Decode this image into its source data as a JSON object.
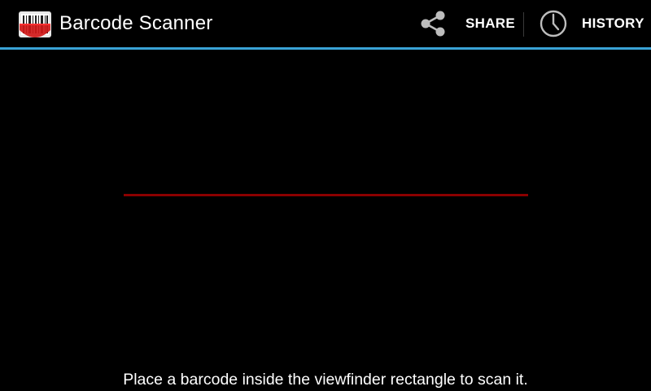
{
  "app": {
    "title": "Barcode Scanner",
    "icon": "barcode-scanner-icon"
  },
  "actions": {
    "share_label": "SHARE",
    "share_icon": "share-icon",
    "history_label": "HISTORY",
    "history_icon": "clock-icon"
  },
  "viewfinder": {
    "status_text": "Place a barcode inside the viewfinder rectangle to scan it."
  },
  "colors": {
    "background": "#000000",
    "accent_divider": "#3aa3d6",
    "laser": "#8b0000",
    "text": "#ffffff"
  }
}
